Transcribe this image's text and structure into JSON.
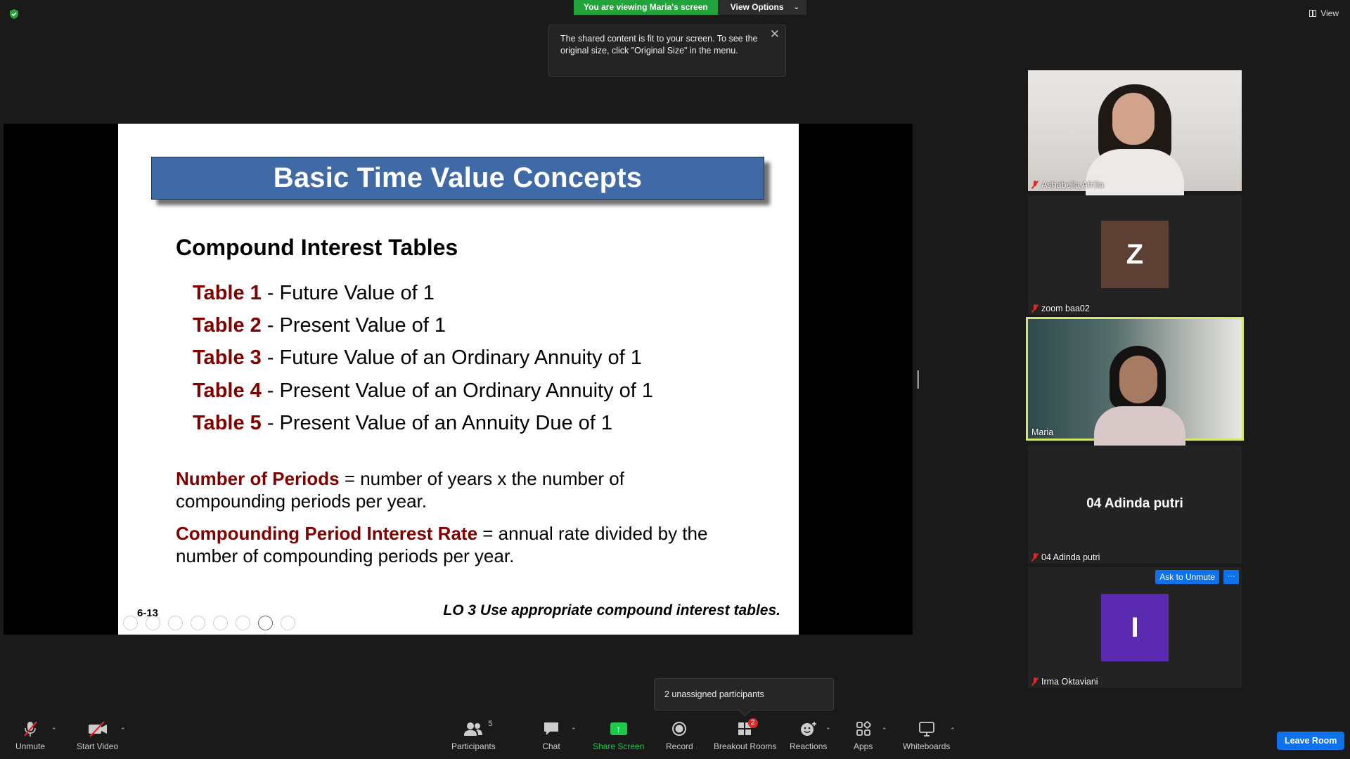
{
  "banner": {
    "viewing": "You are viewing Maria's screen",
    "view_options": "View Options",
    "view_options_caret": "⌄"
  },
  "top_right": {
    "view_label": "View"
  },
  "tooltip": {
    "text": "The shared content is fit to your screen. To see the original size, click \"Original Size\" in the menu.",
    "close": "✕"
  },
  "slide": {
    "title": "Basic Time Value Concepts",
    "subtitle": "Compound Interest Tables",
    "tables": [
      {
        "label": "Table 1",
        "text": " - Future Value of 1"
      },
      {
        "label": "Table 2",
        "text": " - Present Value of 1"
      },
      {
        "label": "Table 3",
        "text": " - Future Value of an Ordinary Annuity of 1"
      },
      {
        "label": "Table 4",
        "text": " - Present Value of an Ordinary Annuity of 1"
      },
      {
        "label": "Table 5",
        "text": " - Present Value of an Annuity Due of 1"
      }
    ],
    "definitions": [
      {
        "label": "Number of Periods",
        "text": " = number of years x the number of compounding periods per year."
      },
      {
        "label": "Compounding Period Interest Rate",
        "text": " = annual rate divided by the number of compounding periods per year."
      }
    ],
    "number": "6-13",
    "lo": "LO 3  Use appropriate compound interest tables."
  },
  "participants": [
    {
      "name": "Ashabella Afrilia",
      "muted": true
    },
    {
      "name": "zoom baa02",
      "initial": "Z",
      "avatar_color": "#5c4033",
      "muted": true
    },
    {
      "name": "Maria",
      "muted": false,
      "active_speaker": true
    },
    {
      "name": "04 Adinda putri",
      "display": "04 Adinda putri",
      "muted": true
    },
    {
      "name": "Irma Oktaviani",
      "initial": "I",
      "avatar_color": "#5a2ab0",
      "muted": true
    }
  ],
  "ask_to_unmute": "Ask to Unmute",
  "more": "···",
  "unassigned": "2 unassigned participants",
  "toolbar": {
    "unmute": "Unmute",
    "start_video": "Start Video",
    "participants": "Participants",
    "participants_count": "5",
    "chat": "Chat",
    "share_screen": "Share Screen",
    "record": "Record",
    "breakout_rooms": "Breakout Rooms",
    "breakout_badge": "2",
    "reactions": "Reactions",
    "apps": "Apps",
    "whiteboards": "Whiteboards",
    "caret": "⌃",
    "leave_room": "Leave Room"
  },
  "colors": {
    "accent_green": "#23a33b",
    "accent_blue": "#0e72ed",
    "slide_title_bg": "#3f6aa5",
    "slide_label": "#800000",
    "speaker_border": "#d7e66a",
    "muted_red": "#e02828"
  }
}
